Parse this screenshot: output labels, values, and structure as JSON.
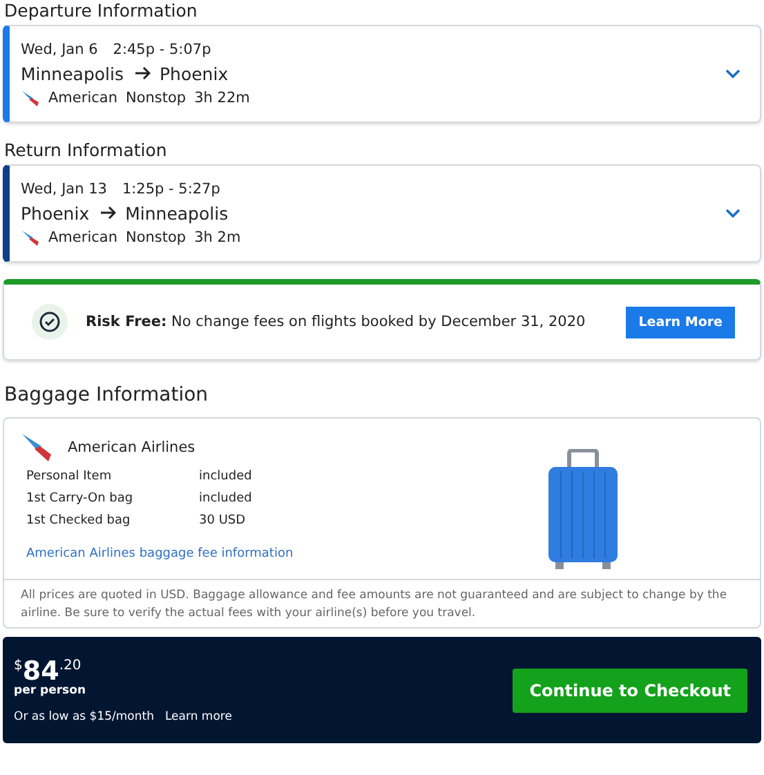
{
  "flights": [
    {
      "heading": "Departure Information",
      "color": "#1a7ae8",
      "date": "Wed, Jan 6",
      "time": "2:45p - 5:07p",
      "from": "Minneapolis",
      "to": "Phoenix",
      "airline": "American",
      "stops": "Nonstop",
      "duration": "3h 22m"
    },
    {
      "heading": "Return Information",
      "color": "#0d3f8a",
      "date": "Wed, Jan 13",
      "time": "1:25p - 5:27p",
      "from": "Phoenix",
      "to": "Minneapolis",
      "airline": "American",
      "stops": "Nonstop",
      "duration": "3h 2m"
    }
  ],
  "banner": {
    "text": "**Risk Free:** No change fees on flights booked by December 31, 2020",
    "button": "Learn More"
  },
  "baggage": {
    "heading": "Baggage Information",
    "airline": "American Airlines",
    "rows": [
      {
        "item": "Personal Item",
        "fee": "included"
      },
      {
        "item": "1st Carry-On bag",
        "fee": "included"
      },
      {
        "item": "1st Checked bag",
        "fee": "30 USD"
      }
    ],
    "link": "American Airlines baggage fee information",
    "disclaimer": "All prices are quoted in USD. Baggage allowance and fee amounts are not guaranteed and are subject to change by the airline. Be sure to verify the actual fees with your airline(s) before you travel."
  },
  "checkout": {
    "currency": "$",
    "whole": "84",
    "cents": ".20",
    "per": "per person",
    "financing": "Or as low as $15/month",
    "learn": "Learn more",
    "button": "Continue to Checkout"
  }
}
